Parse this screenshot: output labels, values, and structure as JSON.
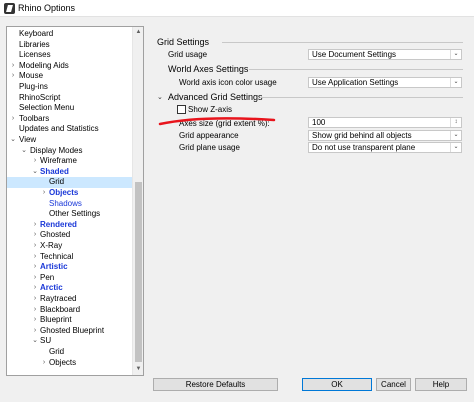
{
  "window": {
    "title": "Rhino Options"
  },
  "tree": {
    "items": [
      {
        "label": "Keyboard",
        "arrow": ""
      },
      {
        "label": "Libraries",
        "arrow": ""
      },
      {
        "label": "Licenses",
        "arrow": ""
      },
      {
        "label": "Modeling Aids",
        "arrow": ">"
      },
      {
        "label": "Mouse",
        "arrow": ">"
      },
      {
        "label": "Plug-ins",
        "arrow": ""
      },
      {
        "label": "RhinoScript",
        "arrow": ""
      },
      {
        "label": "Selection Menu",
        "arrow": ""
      },
      {
        "label": "Toolbars",
        "arrow": ">"
      },
      {
        "label": "Updates and Statistics",
        "arrow": ""
      },
      {
        "label": "View",
        "arrow": "v"
      },
      {
        "label": "Display Modes",
        "arrow": "v"
      },
      {
        "label": "Wireframe",
        "arrow": ">"
      },
      {
        "label": "Shaded",
        "arrow": "v"
      },
      {
        "label": "Grid",
        "arrow": ""
      },
      {
        "label": "Objects",
        "arrow": ">"
      },
      {
        "label": "Shadows",
        "arrow": ""
      },
      {
        "label": "Other Settings",
        "arrow": ""
      },
      {
        "label": "Rendered",
        "arrow": ">"
      },
      {
        "label": "Ghosted",
        "arrow": ">"
      },
      {
        "label": "X-Ray",
        "arrow": ">"
      },
      {
        "label": "Technical",
        "arrow": ">"
      },
      {
        "label": "Artistic",
        "arrow": ">"
      },
      {
        "label": "Pen",
        "arrow": ">"
      },
      {
        "label": "Arctic",
        "arrow": ">"
      },
      {
        "label": "Raytraced",
        "arrow": ">"
      },
      {
        "label": "Blackboard",
        "arrow": ">"
      },
      {
        "label": "Blueprint",
        "arrow": ">"
      },
      {
        "label": "Ghosted Blueprint",
        "arrow": ">"
      },
      {
        "label": "SU",
        "arrow": "v"
      },
      {
        "label": "Grid",
        "arrow": ""
      },
      {
        "label": "Objects",
        "arrow": ">"
      }
    ]
  },
  "grid_settings": {
    "heading": "Grid Settings",
    "grid_usage_label": "Grid usage",
    "grid_usage_value": "Use Document Settings"
  },
  "world_axes": {
    "heading": "World Axes Settings",
    "icon_color_label": "World axis icon color usage",
    "icon_color_value": "Use Application Settings"
  },
  "advanced_grid": {
    "heading": "Advanced Grid Settings",
    "show_z_axis_label": "Show Z-axis",
    "axes_size_label": "Axes size (grid extent %):",
    "axes_size_value": "100",
    "grid_appearance_label": "Grid appearance",
    "grid_appearance_value": "Show grid behind all objects",
    "grid_plane_label": "Grid plane usage",
    "grid_plane_value": "Do not use transparent plane"
  },
  "buttons": {
    "restore_defaults": "Restore Defaults",
    "ok": "OK",
    "cancel": "Cancel",
    "help": "Help"
  },
  "colors": {
    "annotation_red": "#e8141c",
    "selection": "#cce8ff",
    "link_blue": "#1a38d8"
  }
}
